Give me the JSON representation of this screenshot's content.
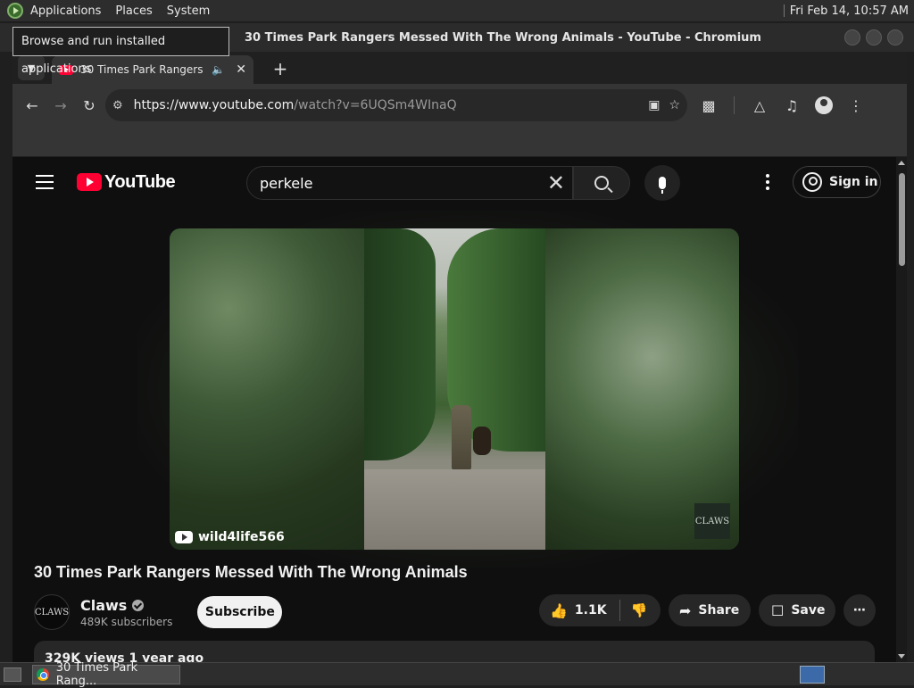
{
  "desktop": {
    "menu": [
      "Applications",
      "Places",
      "System"
    ],
    "clock": "Fri Feb 14, 10:57 AM",
    "tooltip": "Browse and run installed applications"
  },
  "window": {
    "title": "30 Times Park Rangers Messed With The Wrong Animals - YouTube - Chromium"
  },
  "browser": {
    "tab": {
      "title": "30 Times Park Rangers Messed With The Wrong Animals - YouTube"
    },
    "url": {
      "host": "https://www.youtube.com",
      "path": "/watch?v=6UQSm4WInaQ"
    }
  },
  "youtube": {
    "logo_text": "YouTube",
    "search_value": "perkele",
    "sign_in": "Sign in",
    "video": {
      "watermark": "wild4life566",
      "corner_logo": "CLAWS",
      "title": "30 Times Park Rangers Messed With The Wrong Animals"
    },
    "channel": {
      "name": "Claws",
      "avatar_text": "CLAWS",
      "subscribers": "489K subscribers",
      "subscribe_label": "Subscribe"
    },
    "actions": {
      "likes": "1.1K",
      "share": "Share",
      "save": "Save"
    },
    "description_meta": "329K views  1 year ago"
  },
  "taskbar": {
    "item": "30 Times Park Rang..."
  }
}
